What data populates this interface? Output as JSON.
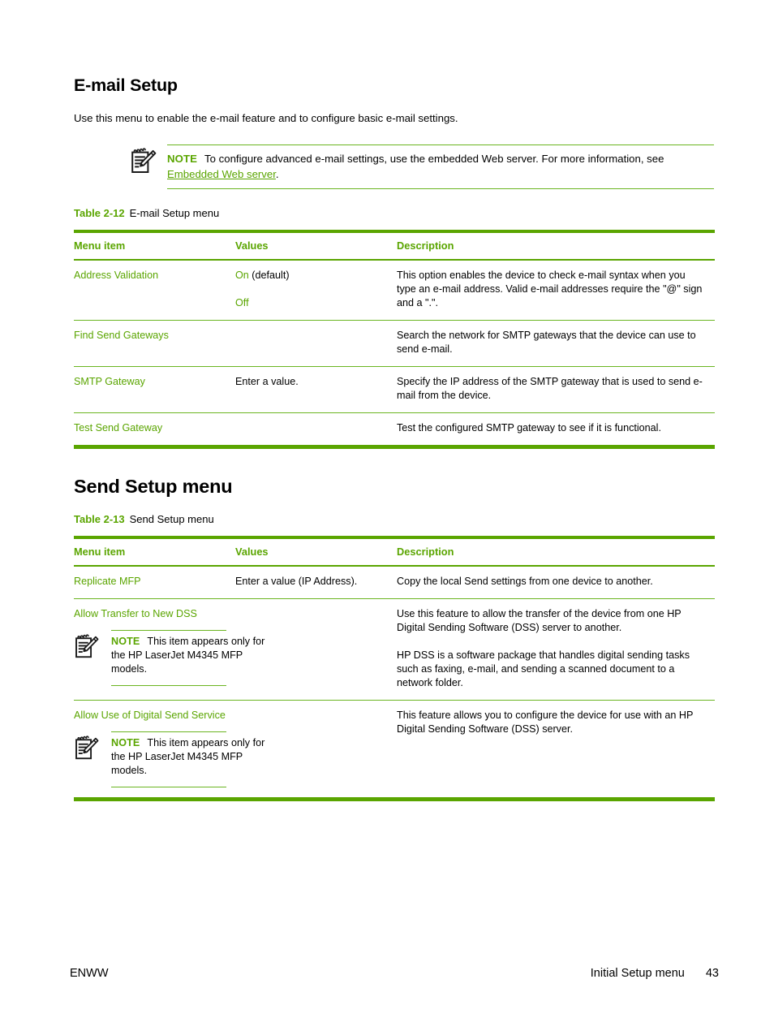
{
  "document": {
    "section_heading": "E-mail Setup",
    "intro_text": "Use this menu to enable the e-mail feature and to configure basic e-mail settings.",
    "accent_color": "#5aa500",
    "rule_color": "#6bb521"
  },
  "note": {
    "label": "NOTE",
    "text_before_link": "To configure advanced e-mail settings, use the embedded Web server. For more information, see ",
    "link_text": "Embedded Web server",
    "text_after_link": ".",
    "icon": "note-pencil-icon"
  },
  "table_email": {
    "caption_number": "Table 2-12",
    "caption_title": "E-mail Setup menu",
    "columns": [
      "Menu item",
      "Values",
      "Description"
    ],
    "rows": [
      {
        "menu_item": "Address Validation",
        "values": [
          {
            "green": "On",
            "black": " (default)"
          },
          {
            "green": "Off",
            "black": ""
          }
        ],
        "description": [
          "This option enables the device to check e-mail syntax when you type an e-mail address. Valid e-mail addresses require the \"@\" sign and a \".\"."
        ]
      },
      {
        "menu_item": "Find Send Gateways",
        "values": [],
        "description": [
          "Search the network for SMTP gateways that the device can use to send e-mail."
        ]
      },
      {
        "menu_item": "SMTP Gateway",
        "values": [
          {
            "green": "",
            "black": "Enter a value."
          }
        ],
        "description": [
          "Specify the IP address of the SMTP gateway that is used to send e-mail from the device."
        ]
      },
      {
        "menu_item": "Test Send Gateway",
        "values": [],
        "description": [
          "Test the configured SMTP gateway to see if it is functional."
        ]
      }
    ]
  },
  "send_setup": {
    "heading": "Send Setup menu",
    "caption_number": "Table 2-13",
    "caption_title": "Send Setup menu",
    "columns": [
      "Menu item",
      "Values",
      "Description"
    ],
    "rows": [
      {
        "menu_item": "Replicate MFP",
        "values": [
          {
            "green": "",
            "black": "Enter a value (IP Address)."
          }
        ],
        "description": [
          "Copy the local Send settings from one device to another."
        ],
        "cell_note": null
      },
      {
        "menu_item": "Allow Transfer to New DSS",
        "values": [],
        "description": [
          "Use this feature to allow the transfer of the device from one HP Digital Sending Software (DSS) server to another.",
          "HP DSS is a software package that handles digital sending tasks such as faxing, e-mail, and sending a scanned document to a network folder."
        ],
        "cell_note": {
          "label": "NOTE",
          "text": "This item appears only for the HP LaserJet M4345 MFP models.",
          "icon": "note-pencil-icon"
        }
      },
      {
        "menu_item": "Allow Use of Digital Send Service",
        "values": [],
        "description": [
          "This feature allows you to configure the device for use with an HP Digital Sending Software (DSS) server."
        ],
        "cell_note": {
          "label": "NOTE",
          "text": "This item appears only for the HP LaserJet M4345 MFP models.",
          "icon": "note-pencil-icon"
        }
      }
    ]
  },
  "footer": {
    "left": "ENWW",
    "chapter": "Initial Setup menu",
    "page_number": "43"
  }
}
